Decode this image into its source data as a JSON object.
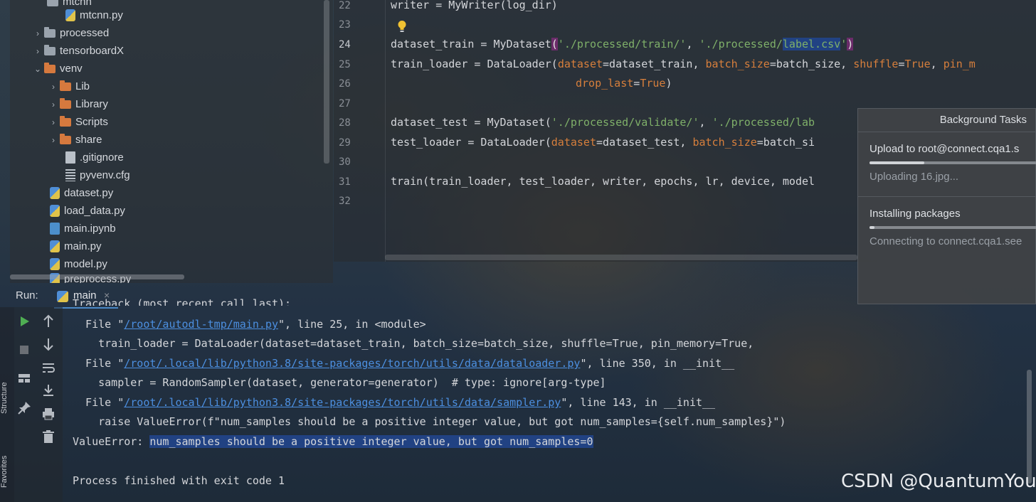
{
  "project_tree": {
    "items": [
      {
        "label": "mtcnn",
        "kind": "folder"
      },
      {
        "label": "mtcnn.py",
        "kind": "py"
      },
      {
        "label": "processed",
        "kind": "folder"
      },
      {
        "label": "tensorboardX",
        "kind": "folder"
      },
      {
        "label": "venv",
        "kind": "folder"
      },
      {
        "label": "Lib",
        "kind": "folder"
      },
      {
        "label": "Library",
        "kind": "folder"
      },
      {
        "label": "Scripts",
        "kind": "folder"
      },
      {
        "label": "share",
        "kind": "folder"
      },
      {
        "label": ".gitignore",
        "kind": "file"
      },
      {
        "label": "pyvenv.cfg",
        "kind": "cfg"
      },
      {
        "label": "dataset.py",
        "kind": "py"
      },
      {
        "label": "load_data.py",
        "kind": "py"
      },
      {
        "label": "main.ipynb",
        "kind": "notebook"
      },
      {
        "label": "main.py",
        "kind": "py"
      },
      {
        "label": "model.py",
        "kind": "py"
      },
      {
        "label": "preprocess.py",
        "kind": "py"
      }
    ],
    "expand_markers": {
      "collapsed": "›",
      "expanded": "⌄"
    }
  },
  "editor": {
    "line_numbers": [
      "22",
      "23",
      "24",
      "25",
      "26",
      "27",
      "28",
      "29",
      "30",
      "31",
      "32"
    ],
    "lines": {
      "l22": "writer = MyWriter(log_dir)",
      "l24_a": "dataset_train = MyDataset",
      "l24_open": "(",
      "l24_s1": "'./processed/train/'",
      "l24_comma": ", ",
      "l24_s2a": "'./processed/",
      "l24_s2b": "label.csv",
      "l24_s2c": "'",
      "l24_close": ")",
      "l25_a": "train_loader = DataLoader(",
      "l25_k1": "dataset",
      "l25_b": "=dataset_train, ",
      "l25_k2": "batch_size",
      "l25_c": "=batch_size, ",
      "l25_k3": "shuffle",
      "l25_d": "=",
      "l25_v3": "True",
      "l25_e": ", ",
      "l25_k4": "pin_m",
      "l26_k": "drop_last",
      "l26_b": "=",
      "l26_v": "True",
      "l26_c": ")",
      "l28_a": "dataset_test = MyDataset(",
      "l28_s1": "'./processed/validate/'",
      "l28_b": ", ",
      "l28_s2": "'./processed/lab",
      "l29_a": "test_loader = DataLoader(",
      "l29_k1": "dataset",
      "l29_b": "=dataset_test, ",
      "l29_k2": "batch_size",
      "l29_c": "=batch_si",
      "l31": "train(train_loader, test_loader, writer, epochs, lr, device, model"
    }
  },
  "background_tasks": {
    "title": "Background Tasks",
    "tasks": [
      {
        "title": "Upload to root@connect.cqa1.s",
        "subtitle": "Uploading 16.jpg...",
        "progress": 0.32
      },
      {
        "title": "Installing packages",
        "subtitle": "Connecting to connect.cqa1.see",
        "progress": 0.03
      }
    ]
  },
  "run": {
    "label": "Run:",
    "tab_label": "main",
    "close_glyph": "×",
    "side_labels": {
      "structure": "Structure",
      "favorites": "Favorites"
    }
  },
  "console": {
    "top_cut": "Traceback (most recent call last):",
    "file1_pre": "  File \"",
    "file1_link": "/root/autodl-tmp/main.py",
    "file1_post": "\", line 25, in <module>",
    "code1": "    train_loader = DataLoader(dataset=dataset_train, batch_size=batch_size, shuffle=True, pin_memory=True,",
    "file2_pre": "  File \"",
    "file2_link": "/root/.local/lib/python3.8/site-packages/torch/utils/data/dataloader.py",
    "file2_post": "\", line 350, in __init__",
    "code2": "    sampler = RandomSampler(dataset, generator=generator)  # type: ignore[arg-type]",
    "file3_pre": "  File \"",
    "file3_link": "/root/.local/lib/python3.8/site-packages/torch/utils/data/sampler.py",
    "file3_post": "\", line 143, in __init__",
    "code3": "    raise ValueError(f\"num_samples should be a positive integer value, but got num_samples={self.num_samples}\")",
    "err_pre": "ValueError: ",
    "err_msg": "num_samples should be a positive integer value, but got num_samples=0",
    "exit_line": "Process finished with exit code 1"
  },
  "watermark": "CSDN @QuantumYou"
}
